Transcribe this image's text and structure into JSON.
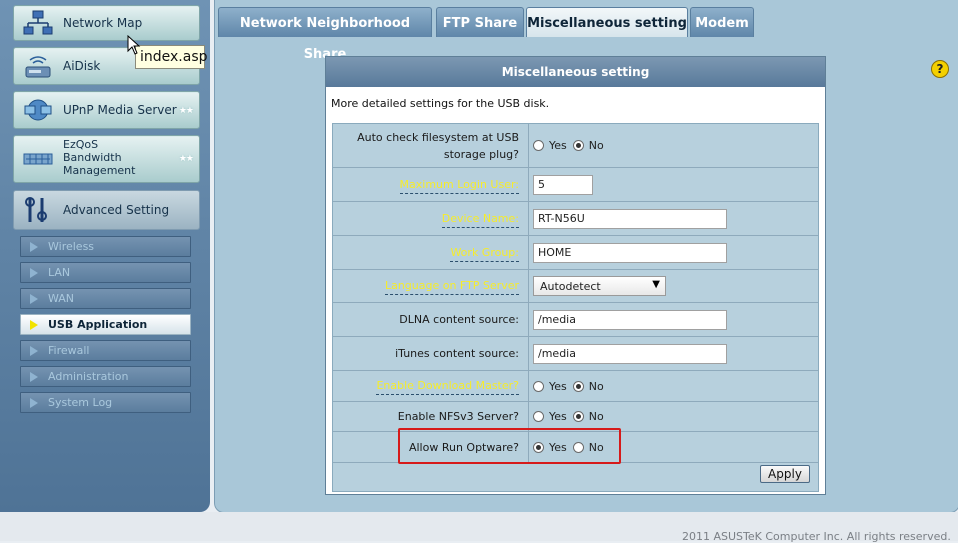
{
  "sidebar": {
    "top_items": [
      {
        "label": "Network Map",
        "icon": "network-map-icon"
      },
      {
        "label": "AiDisk",
        "icon": "aidisk-icon"
      },
      {
        "label": "UPnP Media Server",
        "icon": "upnp-media-server-icon"
      },
      {
        "label": "EzQoS\nBandwidth\nManagement",
        "icon": "ezqos-icon"
      }
    ],
    "advanced": {
      "label": "Advanced Setting",
      "icon": "advanced-setting-icon"
    },
    "sub_items": [
      {
        "label": "Wireless"
      },
      {
        "label": "LAN"
      },
      {
        "label": "WAN"
      },
      {
        "label": "USB Application",
        "active": true
      },
      {
        "label": "Firewall"
      },
      {
        "label": "Administration"
      },
      {
        "label": "System Log"
      }
    ]
  },
  "tooltip": "index.asp",
  "tabs": [
    {
      "label": "Network Neighborhood Share"
    },
    {
      "label": "FTP Share"
    },
    {
      "label": "Miscellaneous setting",
      "active": true
    },
    {
      "label": "Modem"
    }
  ],
  "panel": {
    "title": "Miscellaneous setting",
    "description": "More detailed settings for the USB disk.",
    "fields": {
      "auto_check": {
        "label": "Auto check filesystem at USB storage plug?",
        "yes": "Yes",
        "no": "No",
        "selected": "No"
      },
      "max_login": {
        "label": "Maximum Login User:",
        "value": "5"
      },
      "device_name": {
        "label": "Device Name:",
        "value": "RT-N56U"
      },
      "work_group": {
        "label": "Work Group:",
        "value": "HOME"
      },
      "ftp_language": {
        "label": "Language on FTP Server",
        "value": "Autodetect"
      },
      "dlna_source": {
        "label": "DLNA content source:",
        "value": "/media"
      },
      "itunes_source": {
        "label": "iTunes content source:",
        "value": "/media"
      },
      "download_master": {
        "label": "Enable Download Master?",
        "yes": "Yes",
        "no": "No",
        "selected": "No"
      },
      "nfsv3": {
        "label": "Enable NFSv3 Server?",
        "yes": "Yes",
        "no": "No",
        "selected": "No"
      },
      "optware": {
        "label": "Allow Run Optware?",
        "yes": "Yes",
        "no": "No",
        "selected": "Yes"
      }
    },
    "apply_label": "Apply"
  },
  "help_label": "?",
  "copyright": "2011 ASUSTeK Computer Inc. All rights reserved."
}
